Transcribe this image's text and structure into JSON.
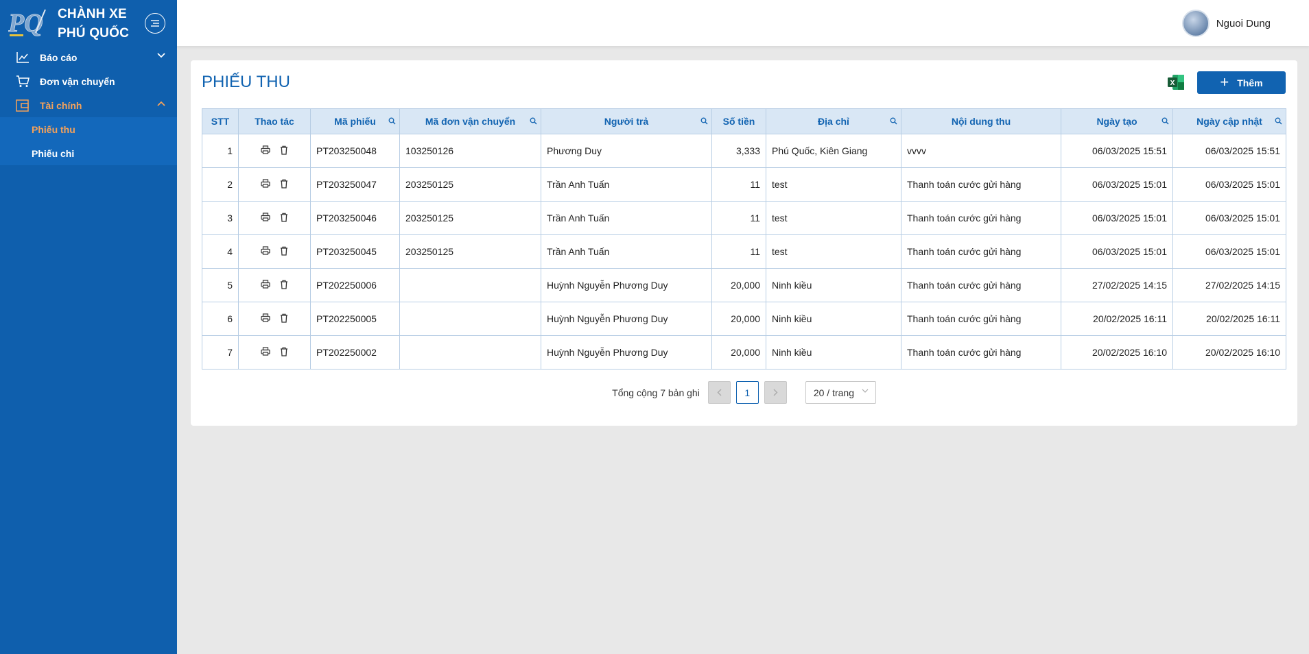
{
  "brand": {
    "line1": "CHÀNH XE",
    "line2": "PHÚ QUỐC"
  },
  "sidebar": {
    "items": [
      {
        "label": "Báo cáo",
        "icon": "chart-line-icon",
        "expanded": false
      },
      {
        "label": "Đơn vận chuyển",
        "icon": "cart-icon"
      },
      {
        "label": "Tài chính",
        "icon": "finance-icon",
        "expanded": true
      }
    ],
    "subitems": [
      {
        "label": "Phiếu thu",
        "active": true
      },
      {
        "label": "Phiếu chi",
        "active": false
      }
    ]
  },
  "header": {
    "user_name": "Nguoi Dung"
  },
  "page": {
    "title": "PHIẾU THU",
    "add_label": "Thêm"
  },
  "table": {
    "columns": [
      "STT",
      "Thao tác",
      "Mã phiếu",
      "Mã đơn vận chuyển",
      "Người trả",
      "Số tiền",
      "Địa chỉ",
      "Nội dung thu",
      "Ngày tạo",
      "Ngày cập nhật"
    ],
    "rows": [
      {
        "stt": "1",
        "ma_phieu": "PT203250048",
        "ma_don": "103250126",
        "nguoi_tra": "Phương Duy",
        "so_tien": "3,333",
        "dia_chi": "Phú Quốc, Kiên Giang",
        "noi_dung": "vvvv",
        "ngay_tao": "06/03/2025 15:51",
        "ngay_cap_nhat": "06/03/2025 15:51"
      },
      {
        "stt": "2",
        "ma_phieu": "PT203250047",
        "ma_don": "203250125",
        "nguoi_tra": "Trần Anh Tuấn",
        "so_tien": "11",
        "dia_chi": "test",
        "noi_dung": "Thanh toán cước gửi hàng",
        "ngay_tao": "06/03/2025 15:01",
        "ngay_cap_nhat": "06/03/2025 15:01"
      },
      {
        "stt": "3",
        "ma_phieu": "PT203250046",
        "ma_don": "203250125",
        "nguoi_tra": "Trần Anh Tuấn",
        "so_tien": "11",
        "dia_chi": "test",
        "noi_dung": "Thanh toán cước gửi hàng",
        "ngay_tao": "06/03/2025 15:01",
        "ngay_cap_nhat": "06/03/2025 15:01"
      },
      {
        "stt": "4",
        "ma_phieu": "PT203250045",
        "ma_don": "203250125",
        "nguoi_tra": "Trần Anh Tuấn",
        "so_tien": "11",
        "dia_chi": "test",
        "noi_dung": "Thanh toán cước gửi hàng",
        "ngay_tao": "06/03/2025 15:01",
        "ngay_cap_nhat": "06/03/2025 15:01"
      },
      {
        "stt": "5",
        "ma_phieu": "PT202250006",
        "ma_don": "",
        "nguoi_tra": "Huỳnh Nguyễn Phương Duy",
        "so_tien": "20,000",
        "dia_chi": "Ninh kiều",
        "noi_dung": "Thanh toán cước gửi hàng",
        "ngay_tao": "27/02/2025 14:15",
        "ngay_cap_nhat": "27/02/2025 14:15"
      },
      {
        "stt": "6",
        "ma_phieu": "PT202250005",
        "ma_don": "",
        "nguoi_tra": "Huỳnh Nguyễn Phương Duy",
        "so_tien": "20,000",
        "dia_chi": "Ninh kiều",
        "noi_dung": "Thanh toán cước gửi hàng",
        "ngay_tao": "20/02/2025 16:11",
        "ngay_cap_nhat": "20/02/2025 16:11"
      },
      {
        "stt": "7",
        "ma_phieu": "PT202250002",
        "ma_don": "",
        "nguoi_tra": "Huỳnh Nguyễn Phương Duy",
        "so_tien": "20,000",
        "dia_chi": "Ninh kiều",
        "noi_dung": "Thanh toán cước gửi hàng",
        "ngay_tao": "20/02/2025 16:10",
        "ngay_cap_nhat": "20/02/2025 16:10"
      }
    ]
  },
  "pagination": {
    "total_text": "Tổng cộng 7 bản ghi",
    "current_page": "1",
    "page_size": "20 / trang"
  },
  "colors": {
    "sidebar": "#0f5fad",
    "accent": "#1163b1",
    "active": "#f5a25a",
    "header_row": "#d9e7f5"
  }
}
